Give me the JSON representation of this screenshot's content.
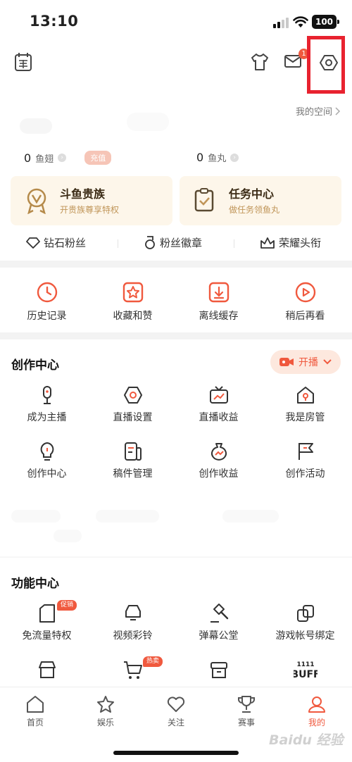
{
  "status_bar": {
    "time": "13:10",
    "battery": "100"
  },
  "header": {
    "mail_badge": "1",
    "my_space": "我的空间"
  },
  "wallet": {
    "fish_fin_count": "0",
    "fish_fin_label": "鱼翅",
    "recharge": "充值",
    "fish_ball_count": "0",
    "fish_ball_label": "鱼丸"
  },
  "promo_cards": [
    {
      "title": "斗鱼贵族",
      "subtitle": "开贵族尊享特权"
    },
    {
      "title": "任务中心",
      "subtitle": "做任务领鱼丸"
    }
  ],
  "sub_links": [
    "钻石粉丝",
    "粉丝徽章",
    "荣耀头衔"
  ],
  "quick_actions": [
    "历史记录",
    "收藏和赞",
    "离线缓存",
    "稍后再看"
  ],
  "creator_center": {
    "title": "创作中心",
    "live_button": "开播",
    "items": [
      "成为主播",
      "直播设置",
      "直播收益",
      "我是房管",
      "创作中心",
      "稿件管理",
      "创作收益",
      "创作活动"
    ]
  },
  "function_center": {
    "title": "功能中心",
    "items": [
      "免流量特权",
      "视频彩铃",
      "弹幕公堂",
      "游戏帐号绑定"
    ],
    "tags": {
      "promo": "促销",
      "hot": "热卖"
    },
    "buff_text_top": "1111",
    "buff_text_bottom": "BUFF"
  },
  "tab_bar": {
    "tabs": [
      "首页",
      "娱乐",
      "关注",
      "赛事",
      "我的"
    ],
    "active": "我的"
  },
  "watermark": "Baidu 经验",
  "colors": {
    "accent": "#f0593e",
    "highlight": "#e8222f",
    "card_bg": "#fdf6ea",
    "gold_text": "#c09558"
  }
}
